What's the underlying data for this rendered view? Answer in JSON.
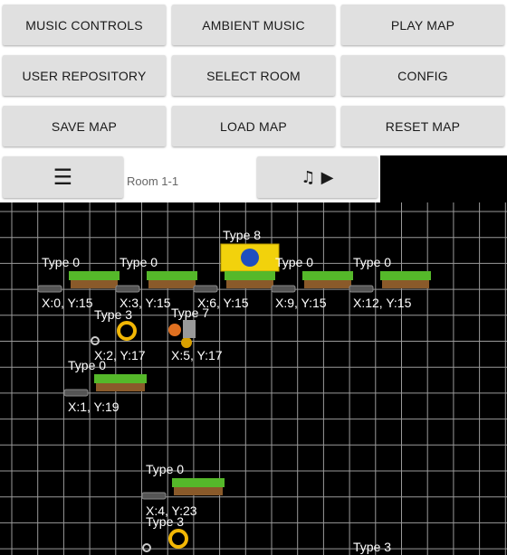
{
  "menu": {
    "music_controls": "MUSIC CONTROLS",
    "ambient_music": "AMBIENT MUSIC",
    "play_map": "PLAY MAP",
    "user_repository": "USER REPOSITORY",
    "select_room": "SELECT ROOM",
    "config": "CONFIG",
    "save_map": "SAVE MAP",
    "load_map": "LOAD MAP",
    "reset_map": "RESET MAP"
  },
  "toolbar": {
    "hamburger_glyph": "☰",
    "room_label": "Room 1-1",
    "music_glyph": "♫ ▶"
  },
  "map": {
    "grid_color": "#9a9a9a",
    "background": "#000000",
    "objects": [
      {
        "kind": "platform",
        "type_label": "Type 0",
        "coord_label": "X:0, Y:15"
      },
      {
        "kind": "platform",
        "type_label": "Type 0",
        "coord_label": "X:3, Y:15"
      },
      {
        "kind": "platform",
        "type_label": "Type 8",
        "coord_label": "X:6, Y:15",
        "has_sprite": true
      },
      {
        "kind": "platform",
        "type_label": "Type 0",
        "coord_label": "X:9, Y:15"
      },
      {
        "kind": "platform",
        "type_label": "Type 0",
        "coord_label": "X:12, Y:15"
      },
      {
        "kind": "ring",
        "type_label": "Type 3",
        "coord_label": "X:2, Y:17"
      },
      {
        "kind": "enemy",
        "type_label": "Type 7",
        "coord_label": "X:5, Y:17"
      },
      {
        "kind": "platform",
        "type_label": "Type 0",
        "coord_label": "X:1, Y:19"
      },
      {
        "kind": "platform",
        "type_label": "Type 0",
        "coord_label": "X:4, Y:23"
      },
      {
        "kind": "ring",
        "type_label": "Type 3",
        "coord_label": ""
      },
      {
        "kind": "label",
        "type_label": "Type 3",
        "coord_label": ""
      }
    ]
  }
}
